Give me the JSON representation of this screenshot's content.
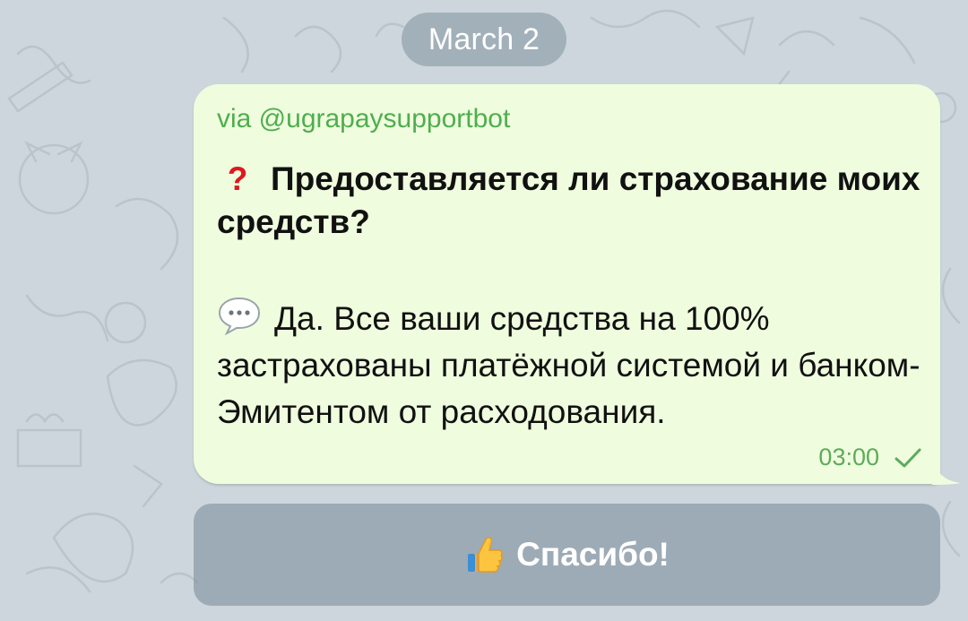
{
  "date_divider": "March 2",
  "message": {
    "via": "via @ugrapaysupportbot",
    "question_icon": "question-mark-icon",
    "question": "Предоставляется ли страхование моих средств?",
    "answer_icon": "speech-bubble-icon",
    "answer": "Да. Все ваши средства на 100% застрахованы платёжной системой и банком-Эмитентом от расходования.",
    "time": "03:00",
    "status_icon": "single-check-icon"
  },
  "keyboard": {
    "button_icon": "thumbs-up-icon",
    "button_label": "Спасибо!"
  },
  "colors": {
    "bubble": "#effdde",
    "via_text": "#4fae4e",
    "time_text": "#5dab5a",
    "question_mark": "#e0171f",
    "background": "#cdd6dc"
  }
}
